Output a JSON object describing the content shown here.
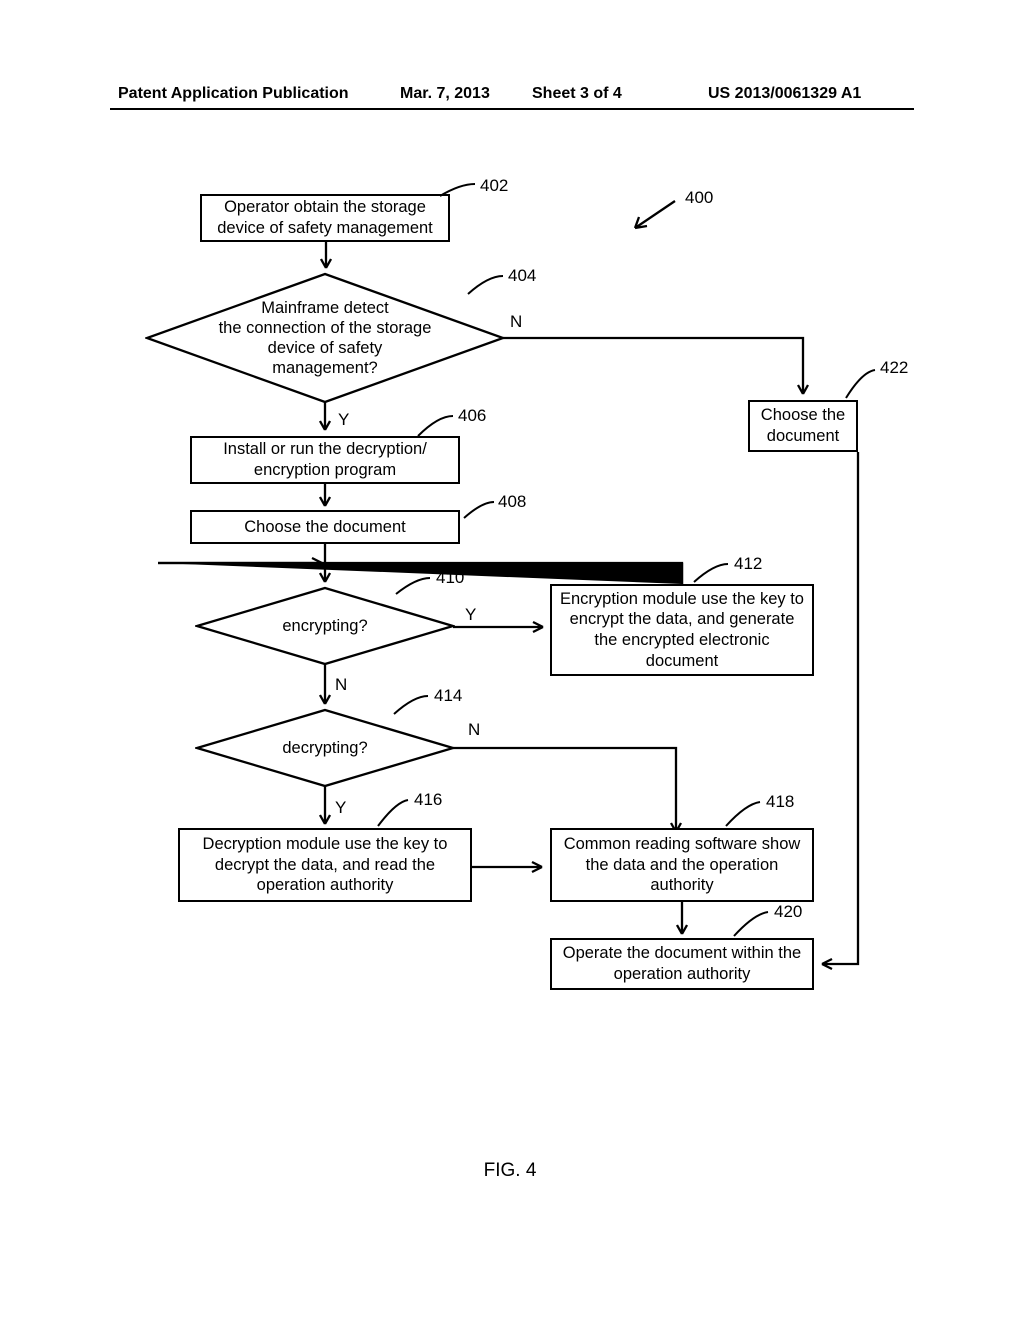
{
  "header": {
    "publication": "Patent Application Publication",
    "date": "Mar. 7, 2013",
    "sheet": "Sheet 3 of 4",
    "pubno": "US 2013/0061329 A1"
  },
  "refs": {
    "r400": "400",
    "r402": "402",
    "r404": "404",
    "r406": "406",
    "r408": "408",
    "r410": "410",
    "r412": "412",
    "r414": "414",
    "r416": "416",
    "r418": "418",
    "r420": "420",
    "r422": "422"
  },
  "yn": {
    "y": "Y",
    "n": "N"
  },
  "nodes": {
    "n402": "Operator obtain the storage device of safety management",
    "n404": "Mainframe detect\nthe connection of the storage\ndevice of safety\nmanagement?",
    "n406": "Install or run the decryption/\nencryption program",
    "n408": "Choose the document",
    "n410": "encrypting?",
    "n412": "Encryption module use the key to encrypt the data, and generate the encrypted electronic document",
    "n414": "decrypting?",
    "n416": "Decryption module use the key to decrypt the data, and read the operation authority",
    "n418": "Common reading software show the data and the operation authority",
    "n420": "Operate the document within the operation authority",
    "n422": "Choose the document"
  },
  "figure": "FIG. 4"
}
